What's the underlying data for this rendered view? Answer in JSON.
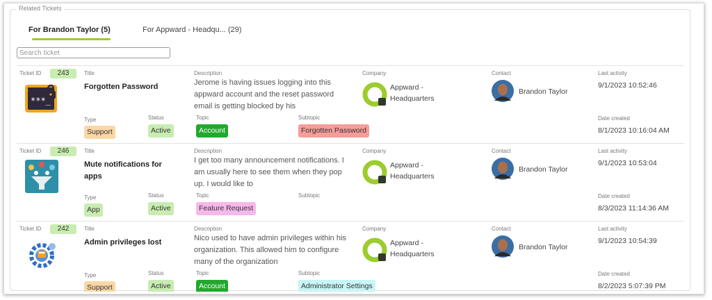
{
  "section": {
    "legend": "Related Tickets",
    "tabs": [
      {
        "label": "For Brandon Taylor (5)",
        "active": true
      },
      {
        "label": "For Appward - Headqu... (29)",
        "active": false
      }
    ],
    "search_placeholder": "Search ticket"
  },
  "labels": {
    "ticket_id": "Ticket ID",
    "title": "Title",
    "description": "Description",
    "company": "Company",
    "contact": "Contact",
    "last_activity": "Last activity",
    "type": "Type",
    "status": "Status",
    "topic": "Topic",
    "subtopic": "Subtopic",
    "date_created": "Date created"
  },
  "tickets": [
    {
      "id": "243",
      "icon": "password-screen-lock-icon",
      "title": "Forgotten Password",
      "description": "Jerome is having issues logging into this appward account and the reset password email is getting blocked by his",
      "company": "Appward - Headquarters",
      "contact": "Brandon Taylor",
      "last_activity": "9/1/2023 10:52:46",
      "type": "Support",
      "status": "Active",
      "topic": "Account",
      "subtopic": "Forgotten Password",
      "date_created": "8/1/2023 10:16:04 AM"
    },
    {
      "id": "246",
      "icon": "notification-funnel-icon",
      "title": "Mute notifications for apps",
      "description": "I get too many announcement notifications. I am usually here to see them when they pop up. I would like to",
      "company": "Appward - Headquarters",
      "contact": "Brandon Taylor",
      "last_activity": "9/1/2023 10:53:04",
      "type": "App",
      "status": "Active",
      "topic": "Feature Request",
      "subtopic": "",
      "date_created": "8/3/2023 11:14:36 AM"
    },
    {
      "id": "242",
      "icon": "admin-gear-icon",
      "title": "Admin privileges lost",
      "description": "Nico used to have admin privileges within his organization. This allowed him to configure many of the organization",
      "company": "Appward - Headquarters",
      "contact": "Brandon Taylor",
      "last_activity": "9/1/2023 10:54:39",
      "type": "Support",
      "status": "Active",
      "topic": "Account",
      "subtopic": "Administrator Settings",
      "date_created": "8/2/2023 5:07:39 PM"
    }
  ],
  "colors": {
    "tab_underline": "#9ccc2e",
    "id_badge": "#c8ecb1",
    "type_support": "#fbd7a6",
    "type_app": "#c8ecb1",
    "status_active": "#c8ecb1",
    "topic_account": "#22a82e",
    "topic_feature_request": "#f6b8ea",
    "subtopic_forgotten_password": "#f59d9a",
    "subtopic_administrator_settings": "#c8f5f5",
    "company_logo": "#9ccc2e"
  }
}
